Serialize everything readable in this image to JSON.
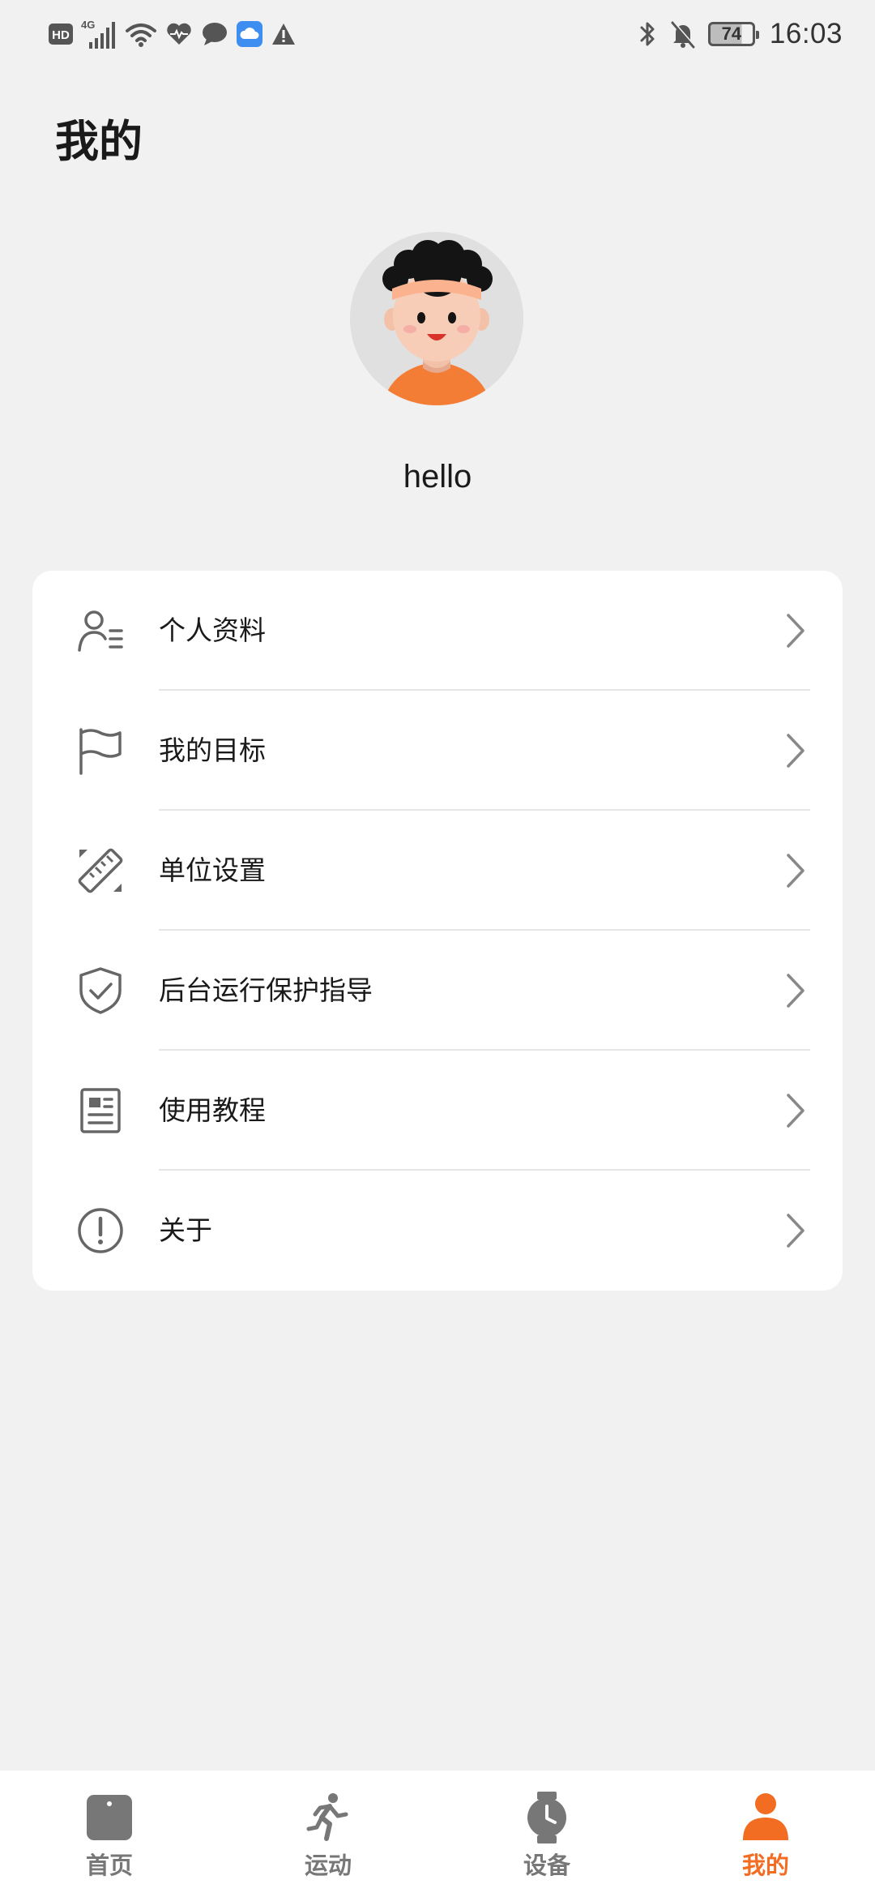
{
  "status_bar": {
    "left_badge": "HD",
    "network": "4G",
    "battery": "74",
    "time": "16:03"
  },
  "page_title": "我的",
  "profile": {
    "username": "hello"
  },
  "menu": {
    "items": [
      {
        "label": "个人资料",
        "icon": "person-list-icon"
      },
      {
        "label": "我的目标",
        "icon": "flag-icon"
      },
      {
        "label": "单位设置",
        "icon": "ruler-icon"
      },
      {
        "label": "后台运行保护指导",
        "icon": "shield-check-icon"
      },
      {
        "label": "使用教程",
        "icon": "document-icon"
      },
      {
        "label": "关于",
        "icon": "info-circle-icon"
      }
    ]
  },
  "bottom_nav": {
    "items": [
      {
        "label": "首页",
        "icon": "home-icon",
        "active": false
      },
      {
        "label": "运动",
        "icon": "running-icon",
        "active": false
      },
      {
        "label": "设备",
        "icon": "watch-icon",
        "active": false
      },
      {
        "label": "我的",
        "icon": "person-icon",
        "active": true
      }
    ]
  },
  "colors": {
    "accent": "#f26c22",
    "background": "#f1f1f1",
    "card": "#ffffff",
    "icon_gray": "#777777"
  }
}
